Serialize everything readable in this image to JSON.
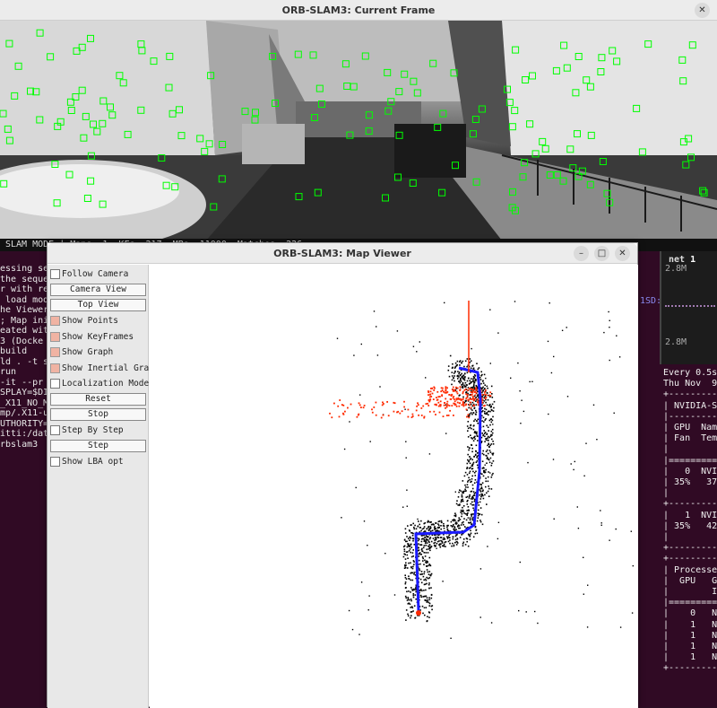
{
  "frame_window": {
    "title": "ORB-SLAM3: Current Frame",
    "status": "SLAM MODE | Maps: 1, KFs: 217, MPs: 11000, Matches: 226"
  },
  "map_window": {
    "title": "ORB-SLAM3: Map Viewer",
    "controls": {
      "follow_camera": "Follow Camera",
      "camera_view": "Camera View",
      "top_view": "Top View",
      "show_points": "Show Points",
      "show_keyframes": "Show KeyFrames",
      "show_graph": "Show Graph",
      "show_inertial_graph": "Show Inertial Graph",
      "localization_mode": "Localization Mode",
      "reset": "Reset",
      "stop": "Stop",
      "step_by_step": "Step By Step",
      "step": "Step",
      "show_lba_opt": "Show LBA opt"
    }
  },
  "terminal_left": {
    "lines": [
      "essing se",
      "the seque",
      "",
      "r with re",
      " load mod",
      "he Viewer",
      "; Map ini",
      "eated wit",
      "",
      "",
      "",
      "3 (Docke",
      "",
      "build",
      "",
      "",
      "ld . -t s",
      "",
      "",
      "run",
      "",
      "",
      "-it --pr",
      "SPLAY=$DI",
      "_X11_NO_M",
      "mp/.X11-u",
      "UTHORITY=",
      "itti:/dat",
      "rbslam3"
    ]
  },
  "terminal_right": {
    "net_label": "net",
    "net_value": "1",
    "rate_top": "2.8M",
    "rate_bot": "2.8M",
    "lines": [
      "Every 0.5s",
      "",
      "Thu Nov  9",
      "+---------",
      "| NVIDIA-S",
      "|---------",
      "| GPU  Nam",
      "| Fan  Temp",
      "|",
      "|=========",
      "|   0  NVI",
      "| 35%   37",
      "|",
      "+---------",
      "|   1  NVI",
      "| 35%   42",
      "|",
      "+---------",
      "",
      "+---------",
      "| Processe",
      "|  GPU   G",
      "|        I",
      "|=========",
      "|    0   N",
      "|    1   N",
      "|    1   N",
      "|    1   N",
      "|    1   N",
      "+---------"
    ]
  },
  "colors": {
    "feature_green": "#00ff00",
    "trajectory_blue": "#1a1aff",
    "local_points_red": "#ff2a00",
    "terminal_bg": "#300a24"
  }
}
